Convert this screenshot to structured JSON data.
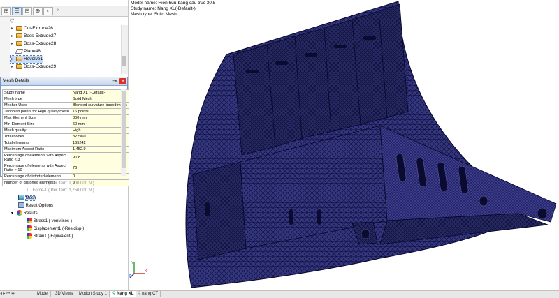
{
  "model_info": {
    "model_name": "Model name: Hien huu-bang cau truc 30.5",
    "study_name": "Study name: Nang XL(-Default-)",
    "mesh_type": "Mesh type: Solid Mesh"
  },
  "feature_tree": {
    "items": [
      {
        "label": "Cut-Extrude26"
      },
      {
        "label": "Boss-Extrude27"
      },
      {
        "label": "Boss-Extrude28"
      },
      {
        "label": "Plane48"
      },
      {
        "label": "Revolve1"
      },
      {
        "label": "Boss-Extrude29"
      }
    ]
  },
  "mesh_details": {
    "title": "Mesh Details",
    "rows": [
      {
        "key": "Study name",
        "value": "Nang XL (-Default-)"
      },
      {
        "key": "Mesh type",
        "value": "Solid Mesh"
      },
      {
        "key": "Mesher Used",
        "value": "Blended curvature-based mesh"
      },
      {
        "key": "Jacobian points for High quality mesh",
        "value": "16 points"
      },
      {
        "key": "Max Element Size",
        "value": "300 mm"
      },
      {
        "key": "Min Element Size",
        "value": "60 mm"
      },
      {
        "key": "Mesh quality",
        "value": "High"
      },
      {
        "key": "Total nodes",
        "value": "322960"
      },
      {
        "key": "Total elements",
        "value": "165242"
      },
      {
        "key": "Maximum Aspect Ratio",
        "value": "1,452.9"
      },
      {
        "key": "Percentage of elements with Aspect Ratio < 3",
        "value": "9.08"
      },
      {
        "key": "Percentage of elements with Aspect Ratio > 10",
        "value": "76"
      },
      {
        "key": "Percentage of distorted elements",
        "value": "0"
      },
      {
        "key": "Number of distorted elements",
        "value": "0"
      }
    ]
  },
  "study_tree": {
    "force3": "Force-3 (:Per item: 2,100,000 N:)",
    "force1": "Force-1 (:Per item: 1,250,000 N:)",
    "mesh": "Mesh",
    "result_options": "Result Options",
    "results": "Results",
    "stress": "Stress1 (-vonMises-)",
    "displacement": "Displacement1 (-Res disp-)",
    "strain": "Strain1 (-Equivalent-)"
  },
  "bottom_tabs": [
    {
      "label": "Model"
    },
    {
      "label": "3D Views"
    },
    {
      "label": "Motion Study 1"
    },
    {
      "label": "Nang XL"
    },
    {
      "label": "nang CT"
    }
  ],
  "colors": {
    "mesh_fill": "#32337a",
    "mesh_line": "#0a0a38",
    "accent": "#4a7cc0"
  }
}
